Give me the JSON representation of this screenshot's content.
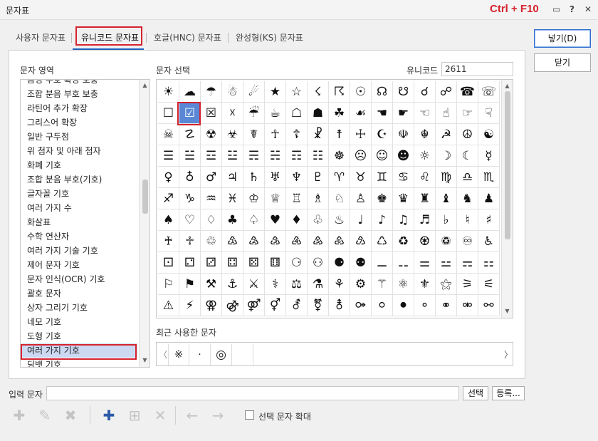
{
  "window": {
    "title": "문자표",
    "shortcut": "Ctrl + F10",
    "icons": [
      "chat-icon",
      "help-icon",
      "close-icon"
    ],
    "icon_glyphs": [
      "▭",
      "?",
      "✕"
    ]
  },
  "tabs": [
    {
      "label": "사용자 문자표",
      "active": false
    },
    {
      "label": "유니코드 문자표",
      "active": true
    },
    {
      "label": "호글(HNC) 문자표",
      "active": false
    },
    {
      "label": "완성형(KS) 문자표",
      "active": false
    }
  ],
  "buttons": {
    "insert": "넣기(D)",
    "close": "닫기",
    "select": "선택",
    "register": "등록..."
  },
  "area": {
    "label": "문자 영역",
    "items": [
      "음성 부호 확장 보충",
      "조합 분음 부호 보충",
      "라틴어 추가 확장",
      "그리스어 확장",
      "일반 구두점",
      "위 첨자 및 아래 첨자",
      "화폐 기호",
      "조합 분음 부호(기호)",
      "글자꼴 기호",
      "여러 가지 수",
      "화살표",
      "수학 연산자",
      "여러 가지 기술 기호",
      "제어 문자 기호",
      "문자 인식(OCR) 기호",
      "괄호 문자",
      "상자 그리기 기호",
      "네모 기호",
      "도형 기호",
      "여러 가지 기호",
      "딩뱃 기호"
    ],
    "selected_index": 19
  },
  "select": {
    "label": "문자 선택",
    "unicode_label": "유니코드",
    "unicode_value": "2611",
    "selected_index": 17,
    "chars": [
      "☀",
      "☁",
      "☂",
      "☃",
      "☄",
      "★",
      "☆",
      "☇",
      "☈",
      "☉",
      "☊",
      "☋",
      "☌",
      "☍",
      "☎",
      "☏",
      "☐",
      "☑",
      "☒",
      "☓",
      "☔",
      "☕",
      "☖",
      "☗",
      "☘",
      "☙",
      "☚",
      "☛",
      "☜",
      "☝",
      "☞",
      "☟",
      "☠",
      "☡",
      "☢",
      "☣",
      "☤",
      "☥",
      "☦",
      "☧",
      "☨",
      "☩",
      "☪",
      "☫",
      "☬",
      "☭",
      "☮",
      "☯",
      "☰",
      "☱",
      "☲",
      "☳",
      "☴",
      "☵",
      "☶",
      "☷",
      "☸",
      "☹",
      "☺",
      "☻",
      "☼",
      "☽",
      "☾",
      "☿",
      "♀",
      "♁",
      "♂",
      "♃",
      "♄",
      "♅",
      "♆",
      "♇",
      "♈",
      "♉",
      "♊",
      "♋",
      "♌",
      "♍",
      "♎",
      "♏",
      "♐",
      "♑",
      "♒",
      "♓",
      "♔",
      "♕",
      "♖",
      "♗",
      "♘",
      "♙",
      "♚",
      "♛",
      "♜",
      "♝",
      "♞",
      "♟",
      "♠",
      "♡",
      "♢",
      "♣",
      "♤",
      "♥",
      "♦",
      "♧",
      "♨",
      "♩",
      "♪",
      "♫",
      "♬",
      "♭",
      "♮",
      "♯",
      "♰",
      "♱",
      "♲",
      "♳",
      "♴",
      "♵",
      "♶",
      "♷",
      "♸",
      "♹",
      "♺",
      "♻",
      "♼",
      "♽",
      "♾",
      "♿",
      "⚀",
      "⚁",
      "⚂",
      "⚃",
      "⚄",
      "⚅",
      "⚆",
      "⚇",
      "⚈",
      "⚉",
      "⚊",
      "⚋",
      "⚌",
      "⚍",
      "⚎",
      "⚏",
      "⚐",
      "⚑",
      "⚒",
      "⚓",
      "⚔",
      "⚕",
      "⚖",
      "⚗",
      "⚘",
      "⚙",
      "⚚",
      "⚛",
      "⚜",
      "⚝",
      "⚞",
      "⚟",
      "⚠",
      "⚡",
      "⚢",
      "⚣",
      "⚤",
      "⚥",
      "⚦",
      "⚧",
      "⚨",
      "⚩",
      "⚪",
      "⚫",
      "⚬",
      "⚭",
      "⚮",
      "⚯"
    ]
  },
  "recent": {
    "label": "최근 사용한 문자",
    "chars": [
      "※",
      "·",
      "◎",
      ""
    ],
    "prev": "〈",
    "next": "〉"
  },
  "input": {
    "label": "입력 문자",
    "value": ""
  },
  "toolbar": {
    "icons": [
      "add-user-char-icon",
      "edit-char-icon",
      "delete-user-char-icon",
      "add-icon",
      "add-row-icon",
      "delete-icon",
      "move-left-icon",
      "move-right-icon"
    ],
    "glyphs": [
      "✚",
      "✎",
      "✖",
      "✚",
      "⊞",
      "✕",
      "←",
      "→"
    ],
    "enabled": [
      false,
      false,
      false,
      true,
      false,
      false,
      false,
      false
    ]
  },
  "enlarge": {
    "label": "선택 문자 확대",
    "checked": false
  }
}
